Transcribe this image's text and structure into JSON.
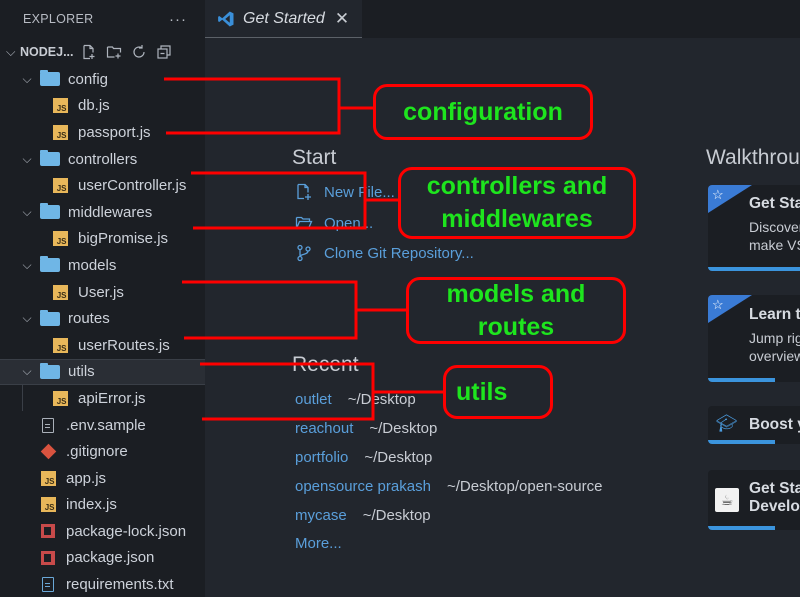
{
  "sidebar": {
    "title": "EXPLORER",
    "more_label": "···",
    "project_name": "NODEJ...",
    "project_actions": [
      "new-file-icon",
      "new-folder-icon",
      "refresh-icon",
      "collapse-all-icon"
    ],
    "tree": [
      {
        "label": "config",
        "type": "folder",
        "depth": 1
      },
      {
        "label": "db.js",
        "type": "js",
        "depth": 2
      },
      {
        "label": "passport.js",
        "type": "js",
        "depth": 2
      },
      {
        "label": "controllers",
        "type": "folder",
        "depth": 1
      },
      {
        "label": "userController.js",
        "type": "js",
        "depth": 2
      },
      {
        "label": "middlewares",
        "type": "folder",
        "depth": 1
      },
      {
        "label": "bigPromise.js",
        "type": "js",
        "depth": 2
      },
      {
        "label": "models",
        "type": "folder",
        "depth": 1
      },
      {
        "label": "User.js",
        "type": "js",
        "depth": 2
      },
      {
        "label": "routes",
        "type": "folder",
        "depth": 1
      },
      {
        "label": "userRoutes.js",
        "type": "js",
        "depth": 2
      },
      {
        "label": "utils",
        "type": "folder",
        "depth": 1,
        "selected": true
      },
      {
        "label": "apiError.js",
        "type": "js",
        "depth": 2
      },
      {
        "label": ".env.sample",
        "type": "file",
        "depth": 1
      },
      {
        "label": ".gitignore",
        "type": "git",
        "depth": 1
      },
      {
        "label": "app.js",
        "type": "js",
        "depth": 1
      },
      {
        "label": "index.js",
        "type": "js",
        "depth": 1
      },
      {
        "label": "package-lock.json",
        "type": "npm",
        "depth": 1
      },
      {
        "label": "package.json",
        "type": "npm",
        "depth": 1
      },
      {
        "label": "requirements.txt",
        "type": "text",
        "depth": 1
      }
    ]
  },
  "tab": {
    "title": "Get Started",
    "close": "✕"
  },
  "start": {
    "heading": "Start",
    "items": [
      {
        "label": "New File...",
        "icon": "new-file-icon"
      },
      {
        "label": "Open...",
        "icon": "open-folder-icon"
      },
      {
        "label": "Clone Git Repository...",
        "icon": "git-branch-icon"
      }
    ]
  },
  "recent": {
    "heading": "Recent",
    "items": [
      {
        "name": "outlet",
        "path": "~/Desktop"
      },
      {
        "name": "reachout",
        "path": "~/Desktop"
      },
      {
        "name": "portfolio",
        "path": "~/Desktop"
      },
      {
        "name": "opensource prakash",
        "path": "~/Desktop/open-source"
      },
      {
        "name": "mycase",
        "path": "~/Desktop"
      }
    ],
    "more": "More..."
  },
  "walkthroughs": {
    "heading": "Walkthroughs",
    "cards": [
      {
        "title": "Get Started with VS Code",
        "desc1": "Discover the best customizations to",
        "desc2": "make VS Code yours.",
        "icon": "star-icon",
        "progress": 1.0
      },
      {
        "title": "Learn the Fundamentals",
        "desc1": "Jump right into VS Code and get an",
        "desc2": "overview of the must-have features.",
        "icon": "star-icon",
        "progress": 0.5
      },
      {
        "title": "Boost your Productivity",
        "icon": "graduation-cap-icon",
        "progress": 0.5
      },
      {
        "title": "Get Started with Java",
        "desc1": "Development",
        "icon": "java-cup-icon",
        "progress": 0.5
      }
    ]
  },
  "annotations": [
    {
      "label": "configuration"
    },
    {
      "label": "controllers and middlewares"
    },
    {
      "label": "models and routes"
    },
    {
      "label": "utils"
    }
  ],
  "colors": {
    "annotation_line": "#ff0000",
    "annotation_text": "#1ee51e",
    "link": "#5a9fdb",
    "accent": "#3b94dd"
  }
}
